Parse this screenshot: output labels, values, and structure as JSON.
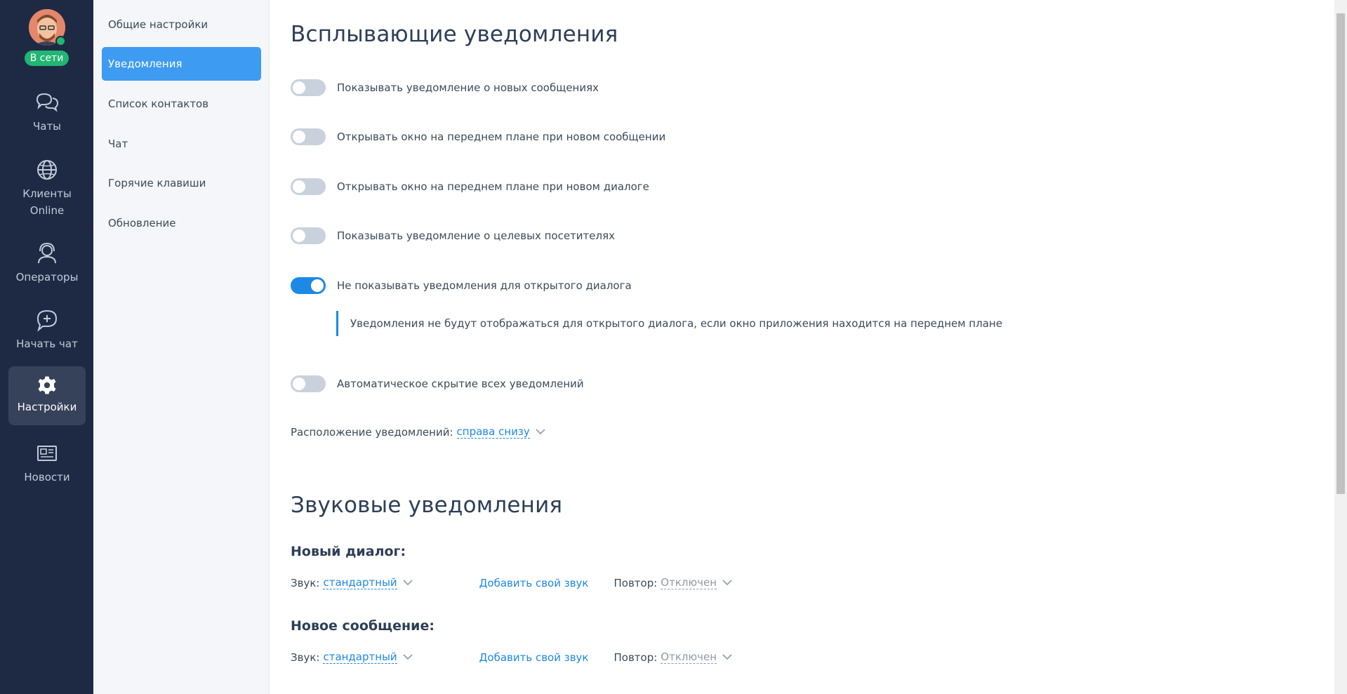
{
  "user": {
    "status": "В сети"
  },
  "nav": {
    "items": [
      {
        "label": "Чаты",
        "icon": "chat-bubbles-icon"
      },
      {
        "label": "Клиенты Online",
        "icon": "globe-icon"
      },
      {
        "label": "Операторы",
        "icon": "operator-headset-icon"
      },
      {
        "label": "Начать чат",
        "icon": "add-chat-icon"
      },
      {
        "label": "Настройки",
        "icon": "gear-icon",
        "active": true
      },
      {
        "label": "Новости",
        "icon": "newspaper-icon"
      }
    ]
  },
  "settings_menu": {
    "items": [
      {
        "label": "Общие настройки"
      },
      {
        "label": "Уведомления",
        "active": true
      },
      {
        "label": "Список контактов"
      },
      {
        "label": "Чат"
      },
      {
        "label": "Горячие клавиши"
      },
      {
        "label": "Обновление"
      }
    ]
  },
  "popup": {
    "title": "Всплывающие уведомления",
    "toggles": [
      {
        "label": "Показывать уведомление о новых сообщениях",
        "on": false
      },
      {
        "label": "Открывать окно на переднем плане при новом сообщении",
        "on": false
      },
      {
        "label": "Открывать окно на переднем плане при новом диалоге",
        "on": false
      },
      {
        "label": "Показывать уведомление о целевых посетителях",
        "on": false
      },
      {
        "label": "Не показывать уведомления для открытого диалога",
        "on": true
      },
      {
        "label": "Автоматическое скрытие всех уведомлений",
        "on": false
      }
    ],
    "hint": "Уведомления не будут отображаться для открытого диалога, если окно приложения находится на переднем плане",
    "position_label": "Расположение уведомлений:",
    "position_value": "справа снизу"
  },
  "sound": {
    "title": "Звуковые уведомления",
    "groups": [
      {
        "title": "Новый диалог:",
        "sound_label": "Звук:",
        "sound_value": "стандартный",
        "add_label": "Добавить свой звук",
        "repeat_label": "Повтор:",
        "repeat_value": "Отключен"
      },
      {
        "title": "Новое сообщение:",
        "sound_label": "Звук:",
        "sound_value": "стандартный",
        "add_label": "Добавить свой звук",
        "repeat_label": "Повтор:",
        "repeat_value": "Отключен"
      }
    ]
  },
  "colors": {
    "nav_bg": "#1e2a44",
    "accent": "#1e88e5",
    "active_menu": "#3d9bf2",
    "online": "#22b573"
  }
}
